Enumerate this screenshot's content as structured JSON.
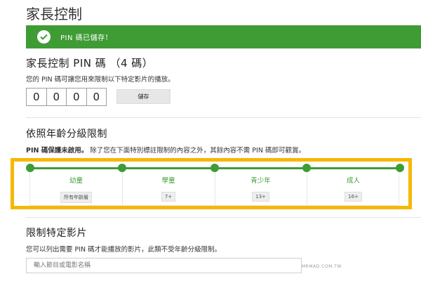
{
  "page": {
    "title": "家長控制"
  },
  "banner": {
    "message": "PIN 碼已儲存！",
    "color": "#3f9c35",
    "icon": "check-icon"
  },
  "pin_section": {
    "title": "家長控制 PIN 碼 （4 碼）",
    "description": "您的 PIN 碼可讓您用來限制以下特定影片的播放。",
    "digits": [
      "0",
      "0",
      "0",
      "0"
    ],
    "save_label": "儲存"
  },
  "age_section": {
    "title": "依照年齡分級限制",
    "status_bold": "PIN 碼保護未啟用。",
    "status_rest": " 除了您在下面特別標註限制的內容之外，其餘內容不需 PIN 碼即可觀賞。",
    "highlight_color": "#f5b800",
    "levels": [
      {
        "label": "幼童",
        "badge": "所有年齡層"
      },
      {
        "label": "學童",
        "badge": "7+"
      },
      {
        "label": "青少年",
        "badge": "13+"
      },
      {
        "label": "成人",
        "badge": "16+"
      }
    ]
  },
  "restrict_section": {
    "title": "限制特定影片",
    "description": "您可以列出需要 PIN 碼才能播放的影片，此類不受年齡分級限制。",
    "search_placeholder": "輸入節目或電影名稱"
  },
  "watermark": "MRMAD.COM.TW"
}
